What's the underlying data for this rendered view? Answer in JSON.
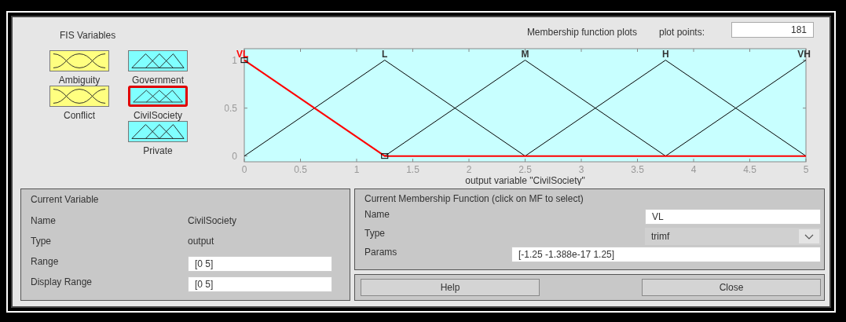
{
  "fis_variables": {
    "title": "FIS Variables",
    "items": [
      {
        "name": "Ambiguity",
        "kind": "input",
        "selected": false
      },
      {
        "name": "Government",
        "kind": "output",
        "selected": false
      },
      {
        "name": "Conflict",
        "kind": "input",
        "selected": false
      },
      {
        "name": "CivilSociety",
        "kind": "output",
        "selected": true
      },
      {
        "name": "Private",
        "kind": "output",
        "selected": false
      }
    ]
  },
  "plot": {
    "title": "Membership function plots",
    "plot_points": {
      "label": "plot points:",
      "value": "181"
    },
    "chart_data": {
      "type": "line",
      "xlabel": "output variable \"CivilSociety\"",
      "x": [
        0,
        1.25,
        2.5,
        3.75,
        5
      ],
      "series": [
        {
          "name": "VL",
          "color": "#ff0000",
          "values": [
            1,
            0,
            0,
            0,
            0
          ]
        },
        {
          "name": "L",
          "color": "#000000",
          "values": [
            0,
            1,
            0,
            null,
            null
          ]
        },
        {
          "name": "M",
          "color": "#000000",
          "values": [
            null,
            0,
            1,
            0,
            null
          ]
        },
        {
          "name": "H",
          "color": "#000000",
          "values": [
            null,
            null,
            0,
            1,
            0
          ]
        },
        {
          "name": "VH",
          "color": "#000000",
          "values": [
            null,
            null,
            null,
            0,
            1
          ]
        }
      ],
      "xlim": [
        0,
        5
      ],
      "ylim": [
        -0.06,
        1.12
      ],
      "xticks": [
        0,
        0.5,
        1,
        1.5,
        2,
        2.5,
        3,
        3.5,
        4,
        4.5,
        5
      ],
      "yticks": [
        0,
        0.5,
        1
      ]
    }
  },
  "current_variable": {
    "title": "Current Variable",
    "rows": [
      {
        "label": "Name",
        "value": "CivilSociety",
        "kind": "text"
      },
      {
        "label": "Type",
        "value": "output",
        "kind": "text"
      },
      {
        "label": "Range",
        "value": "[0 5]",
        "kind": "field"
      },
      {
        "label": "Display Range",
        "value": "[0 5]",
        "kind": "field"
      }
    ]
  },
  "current_mf": {
    "title": "Current Membership Function (click on MF to select)",
    "name": {
      "label": "Name",
      "value": "VL"
    },
    "type": {
      "label": "Type",
      "value": "trimf"
    },
    "params": {
      "label": "Params",
      "value": "[-1.25 -1.388e-17 1.25]"
    }
  },
  "buttons": [
    "Help",
    "Close"
  ]
}
